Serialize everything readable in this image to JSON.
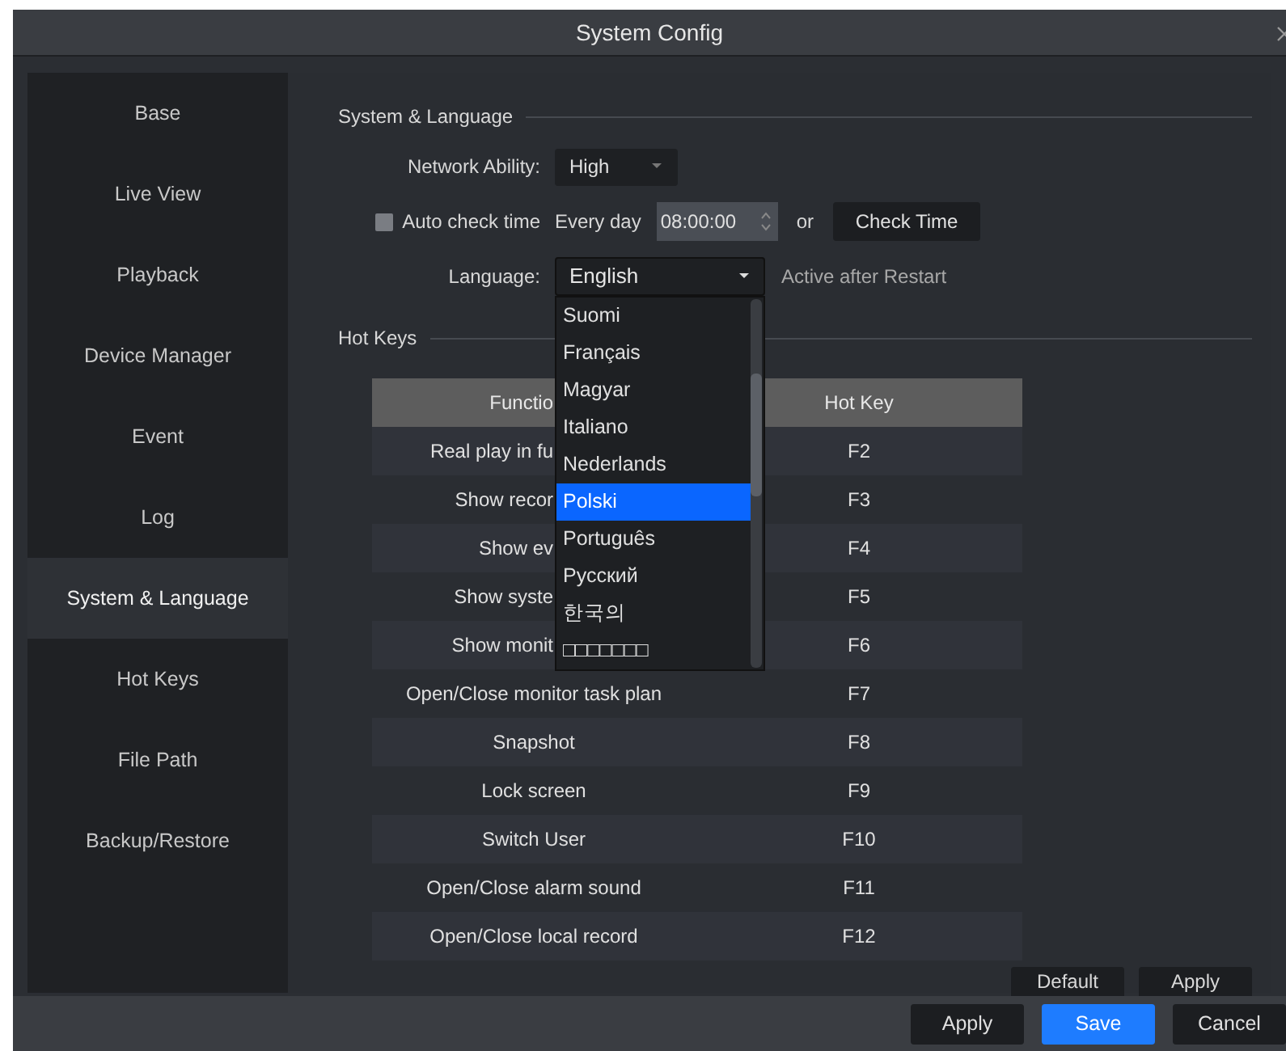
{
  "window": {
    "title": "System Config"
  },
  "sidebar": {
    "items": [
      {
        "label": "Base",
        "selected": false
      },
      {
        "label": "Live View",
        "selected": false
      },
      {
        "label": "Playback",
        "selected": false
      },
      {
        "label": "Device Manager",
        "selected": false
      },
      {
        "label": "Event",
        "selected": false
      },
      {
        "label": "Log",
        "selected": false
      },
      {
        "label": "System & Language",
        "selected": true
      },
      {
        "label": "Hot Keys",
        "selected": false
      },
      {
        "label": "File Path",
        "selected": false
      },
      {
        "label": "Backup/Restore",
        "selected": false
      }
    ]
  },
  "system_language": {
    "heading": "System & Language",
    "network_ability": {
      "label": "Network Ability:",
      "value": "High"
    },
    "auto_check_time": {
      "label": "Auto check time",
      "checked": false,
      "frequency": "Every day",
      "time": "08:00:00",
      "or": "or",
      "button": "Check Time"
    },
    "language": {
      "label": "Language:",
      "value": "English",
      "note": "Active after Restart",
      "expanded": true,
      "options": [
        {
          "label": "Suomi",
          "selected": false
        },
        {
          "label": "Français",
          "selected": false
        },
        {
          "label": "Magyar",
          "selected": false
        },
        {
          "label": "Italiano",
          "selected": false
        },
        {
          "label": "Nederlands",
          "selected": false
        },
        {
          "label": "Polski",
          "selected": true
        },
        {
          "label": "Português",
          "selected": false
        },
        {
          "label": "Русский",
          "selected": false
        },
        {
          "label": "한국의",
          "selected": false
        },
        {
          "label": "□□□□□□□",
          "selected": false
        }
      ]
    }
  },
  "hot_keys": {
    "heading": "Hot Keys",
    "columns": [
      "Functio",
      "Hot Key"
    ],
    "rows": [
      [
        "Real play in fu",
        "F2"
      ],
      [
        "Show recor",
        "F3"
      ],
      [
        "Show ev",
        "F4"
      ],
      [
        "Show syste",
        "F5"
      ],
      [
        "Show monit",
        "F6"
      ],
      [
        "Open/Close monitor task plan",
        "F7"
      ],
      [
        "Snapshot",
        "F8"
      ],
      [
        "Lock screen",
        "F9"
      ],
      [
        "Switch User",
        "F10"
      ],
      [
        "Open/Close alarm sound",
        "F11"
      ],
      [
        "Open/Close local record",
        "F12"
      ]
    ],
    "buttons": [
      "Default",
      "Apply"
    ]
  },
  "footer_buttons": [
    {
      "label": "Apply",
      "kind": "normal"
    },
    {
      "label": "Save",
      "kind": "primary"
    },
    {
      "label": "Cancel",
      "kind": "normal"
    }
  ]
}
